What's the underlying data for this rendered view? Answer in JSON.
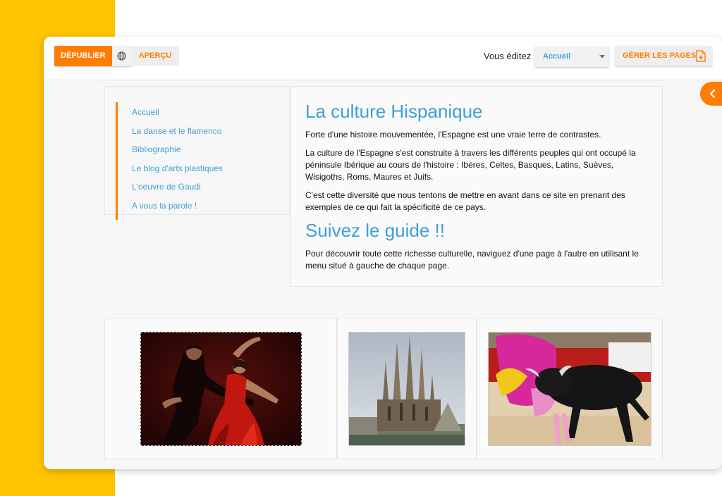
{
  "toolbar": {
    "unpublish_label": "DÉPUBLIER",
    "globe_icon": "globe-icon",
    "preview_label": "APERÇU",
    "editing_label": "Vous éditez :",
    "page_select_value": "Accueil",
    "manage_pages_label": "GÉRER LES PAGES",
    "manage_pages_icon": "add-page-icon"
  },
  "nav": {
    "items": [
      {
        "label": "Accueil"
      },
      {
        "label": "La danse et le flamenco"
      },
      {
        "label": "Bibliographie"
      },
      {
        "label": "Le blog d'arts plastiques"
      },
      {
        "label": "L'oeuvre de Gaudi"
      },
      {
        "label": "A vous la parole !"
      }
    ]
  },
  "content": {
    "title": "La culture Hispanique",
    "p1": "Forte d'une histoire mouvementée, l'Espagne est une vraie terre de contrastes.",
    "p2": "La culture de l'Espagne s'est construite à travers les différents peuples qui ont occupé la péninsule Ibérique au cours de l'histoire : Ibères, Celtes, Basques, Latins, Suèves, Wisigoths, Roms, Maures et Juifs.",
    "p3": "C'est cette diversité que nous tentons de mettre en avant dans ce site en prenant des exemples de ce qui fait la spécificité de ce pays.",
    "subtitle": "Suivez le guide !!",
    "p4": "Pour découvrir toute cette richesse culturelle, naviguez d'une page à l'autre en utilisant le menu situé à gauche de chaque page."
  },
  "images": [
    {
      "subject": "flamenco dancers"
    },
    {
      "subject": "sagrada familia"
    },
    {
      "subject": "bullfight"
    }
  ],
  "colors": {
    "accent": "#ff7d00",
    "link": "#3d9fd6",
    "side_band": "#ffc400"
  }
}
